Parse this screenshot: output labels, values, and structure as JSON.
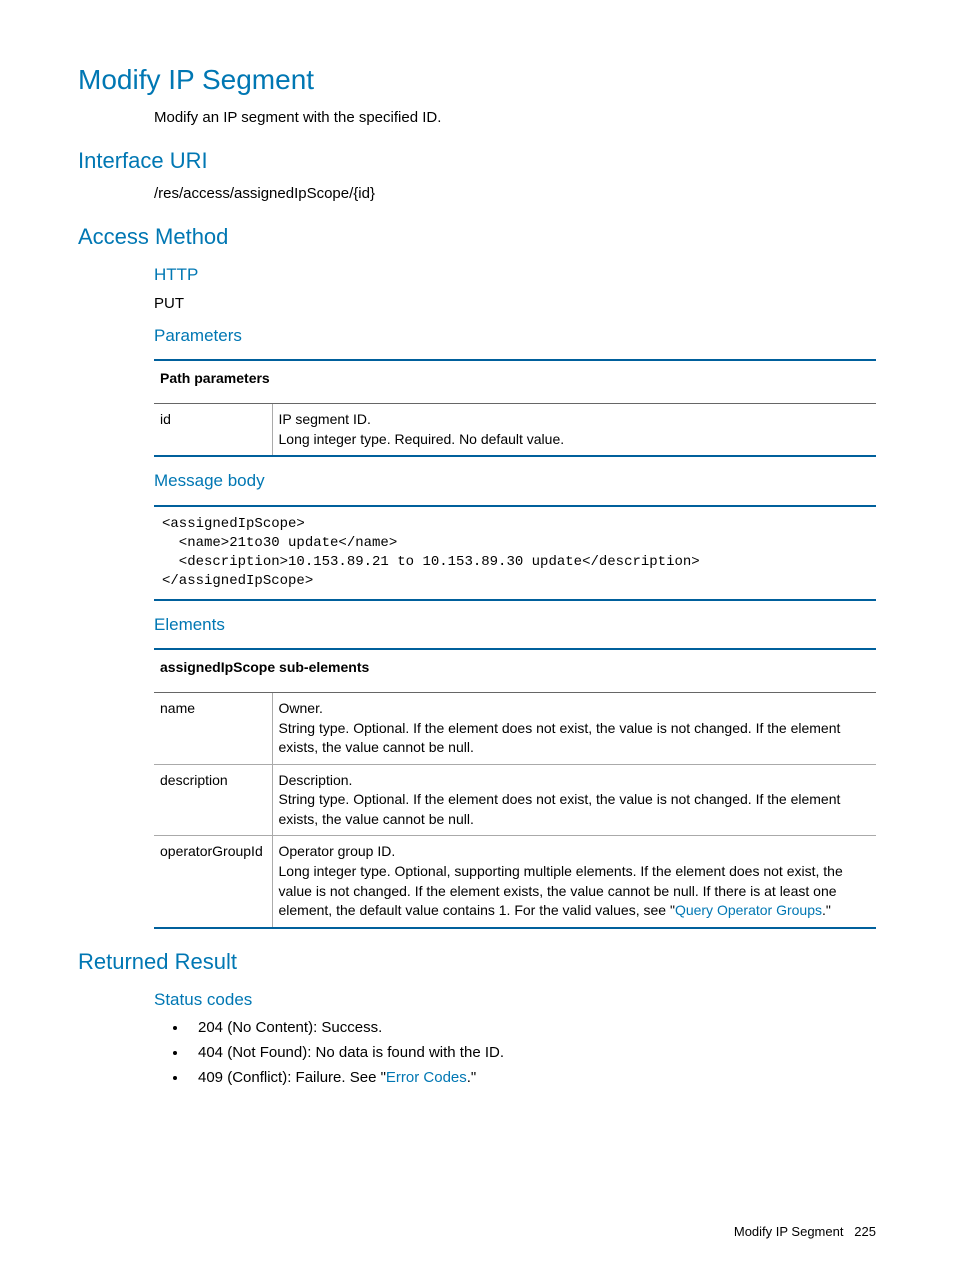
{
  "title": "Modify IP Segment",
  "intro": "Modify an IP segment with the specified ID.",
  "sections": {
    "interface_uri": {
      "heading": "Interface URI",
      "text": "/res/access/assignedIpScope/{id}"
    },
    "access_method": {
      "heading": "Access Method",
      "http_heading": "HTTP",
      "http_value": "PUT",
      "parameters_heading": "Parameters",
      "path_params_table": {
        "header": "Path parameters",
        "rows": [
          {
            "name": "id",
            "desc_line1": "IP segment ID.",
            "desc_line2": "Long integer type. Required. No default value."
          }
        ]
      },
      "message_body_heading": "Message body",
      "message_body_code": "<assignedIpScope>\n  <name>21to30 update</name>\n  <description>10.153.89.21 to 10.153.89.30 update</description>\n</assignedIpScope>",
      "elements_heading": "Elements",
      "elements_table": {
        "header": "assignedIpScope sub-elements",
        "rows": [
          {
            "name": "name",
            "desc_line1": "Owner.",
            "desc_line2": "String type. Optional. If the element does not exist, the value is not changed. If the element exists, the value cannot be null."
          },
          {
            "name": "description",
            "desc_line1": "Description.",
            "desc_line2": "String type. Optional. If the element does not exist, the value is not changed. If the element exists, the value cannot be null."
          },
          {
            "name": "operatorGroupId",
            "desc_line1": "Operator group ID.",
            "desc_prefix": "Long integer type. Optional, supporting multiple elements. If the element does not exist, the value is not changed. If the element exists, the value cannot be null. If there is at least one element, the default value contains 1. For the valid values, see \"",
            "desc_link": "Query Operator Groups",
            "desc_suffix": ".\""
          }
        ]
      }
    },
    "returned_result": {
      "heading": "Returned Result",
      "status_heading": "Status codes",
      "items": [
        {
          "text": "204 (No Content): Success."
        },
        {
          "text": "404 (Not Found): No data is found with the ID."
        },
        {
          "prefix": "409 (Conflict): Failure. See \"",
          "link": "Error Codes",
          "suffix": ".\""
        }
      ]
    }
  },
  "footer": {
    "label": "Modify IP Segment",
    "page": "225"
  }
}
